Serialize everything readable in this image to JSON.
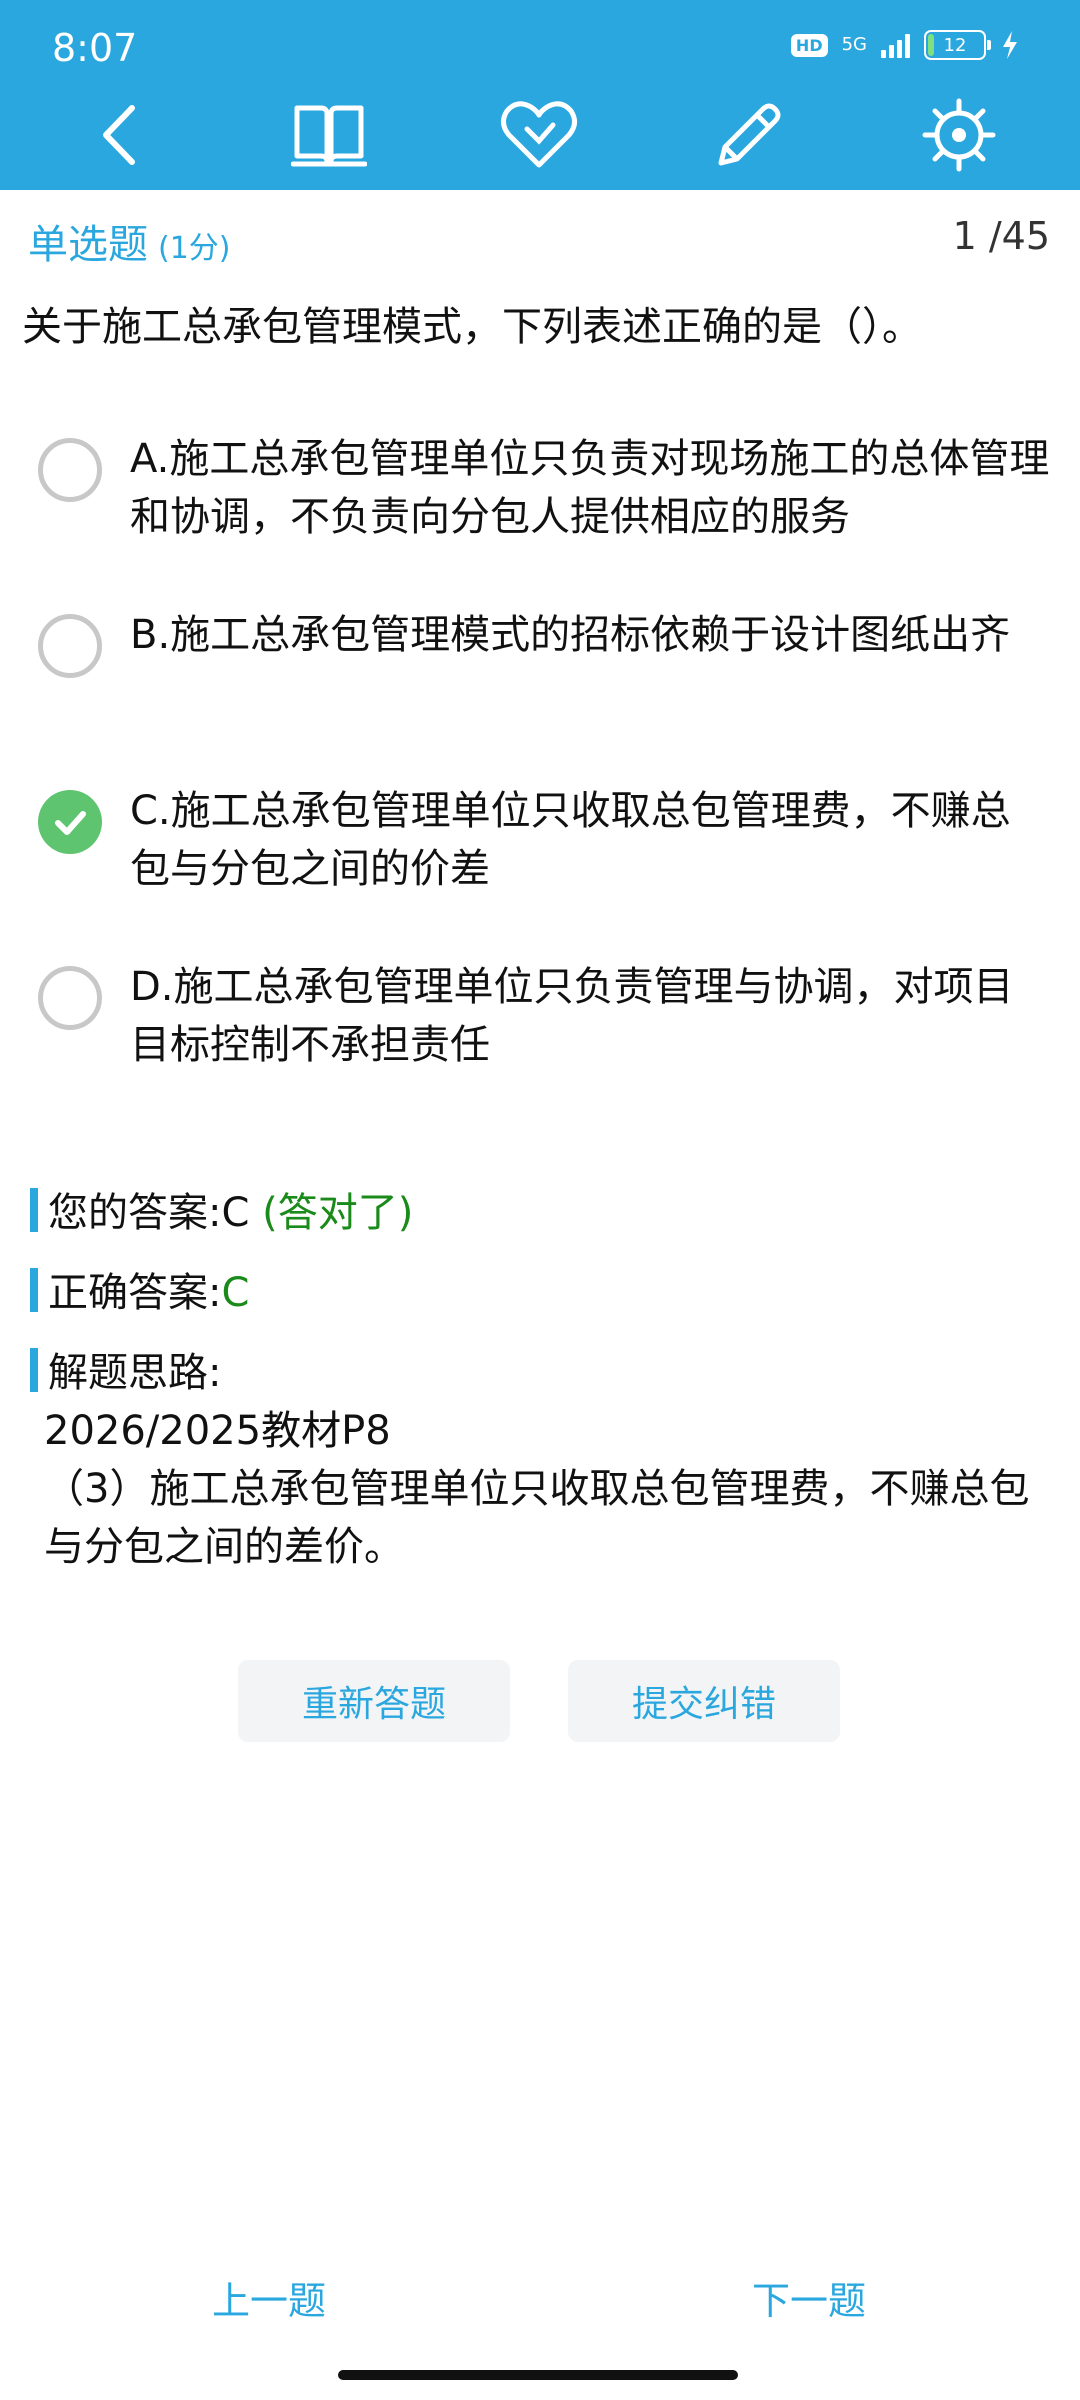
{
  "status_bar": {
    "time": "8:07",
    "hd": "HD",
    "network": "5G",
    "battery": "12"
  },
  "toolbar": {
    "icons": [
      "back-icon",
      "book-icon",
      "heart-icon",
      "pencil-icon",
      "settings-icon"
    ]
  },
  "question_header": {
    "type": "单选题",
    "score": "(1分)",
    "counter": "1 /45"
  },
  "question": {
    "text": "关于施工总承包管理模式，下列表述正确的是（）。"
  },
  "options": [
    {
      "label": "A.施工总承包管理单位只负责对现场施工的总体管理和协调，不负责向分包人提供相应的服务",
      "selected": false
    },
    {
      "label": "B.施工总承包管理模式的招标依赖于设计图纸出齐",
      "selected": false
    },
    {
      "label": "C.施工总承包管理单位只收取总包管理费，不赚总包与分包之间的价差",
      "selected": true
    },
    {
      "label": "D.施工总承包管理单位只负责管理与协调，对项目目标控制不承担责任",
      "selected": false
    }
  ],
  "result": {
    "your_answer_label": "您的答案:",
    "your_answer_value": "C",
    "your_answer_status": "(答对了)",
    "correct_answer_label": "正确答案:",
    "correct_answer_value": "C",
    "analysis_label": "解题思路:",
    "analysis_line1": "2026/2025教材P8",
    "analysis_line2": "（3）施工总承包管理单位只收取总包管理费，不赚总包与分包之间的差价。"
  },
  "actions": {
    "redo": "重新答题",
    "report": "提交纠错"
  },
  "nav": {
    "prev": "上一题",
    "next": "下一题"
  },
  "colors": {
    "primary": "#2aa7df",
    "correct": "#1a8a1a",
    "check": "#5fc46f"
  }
}
